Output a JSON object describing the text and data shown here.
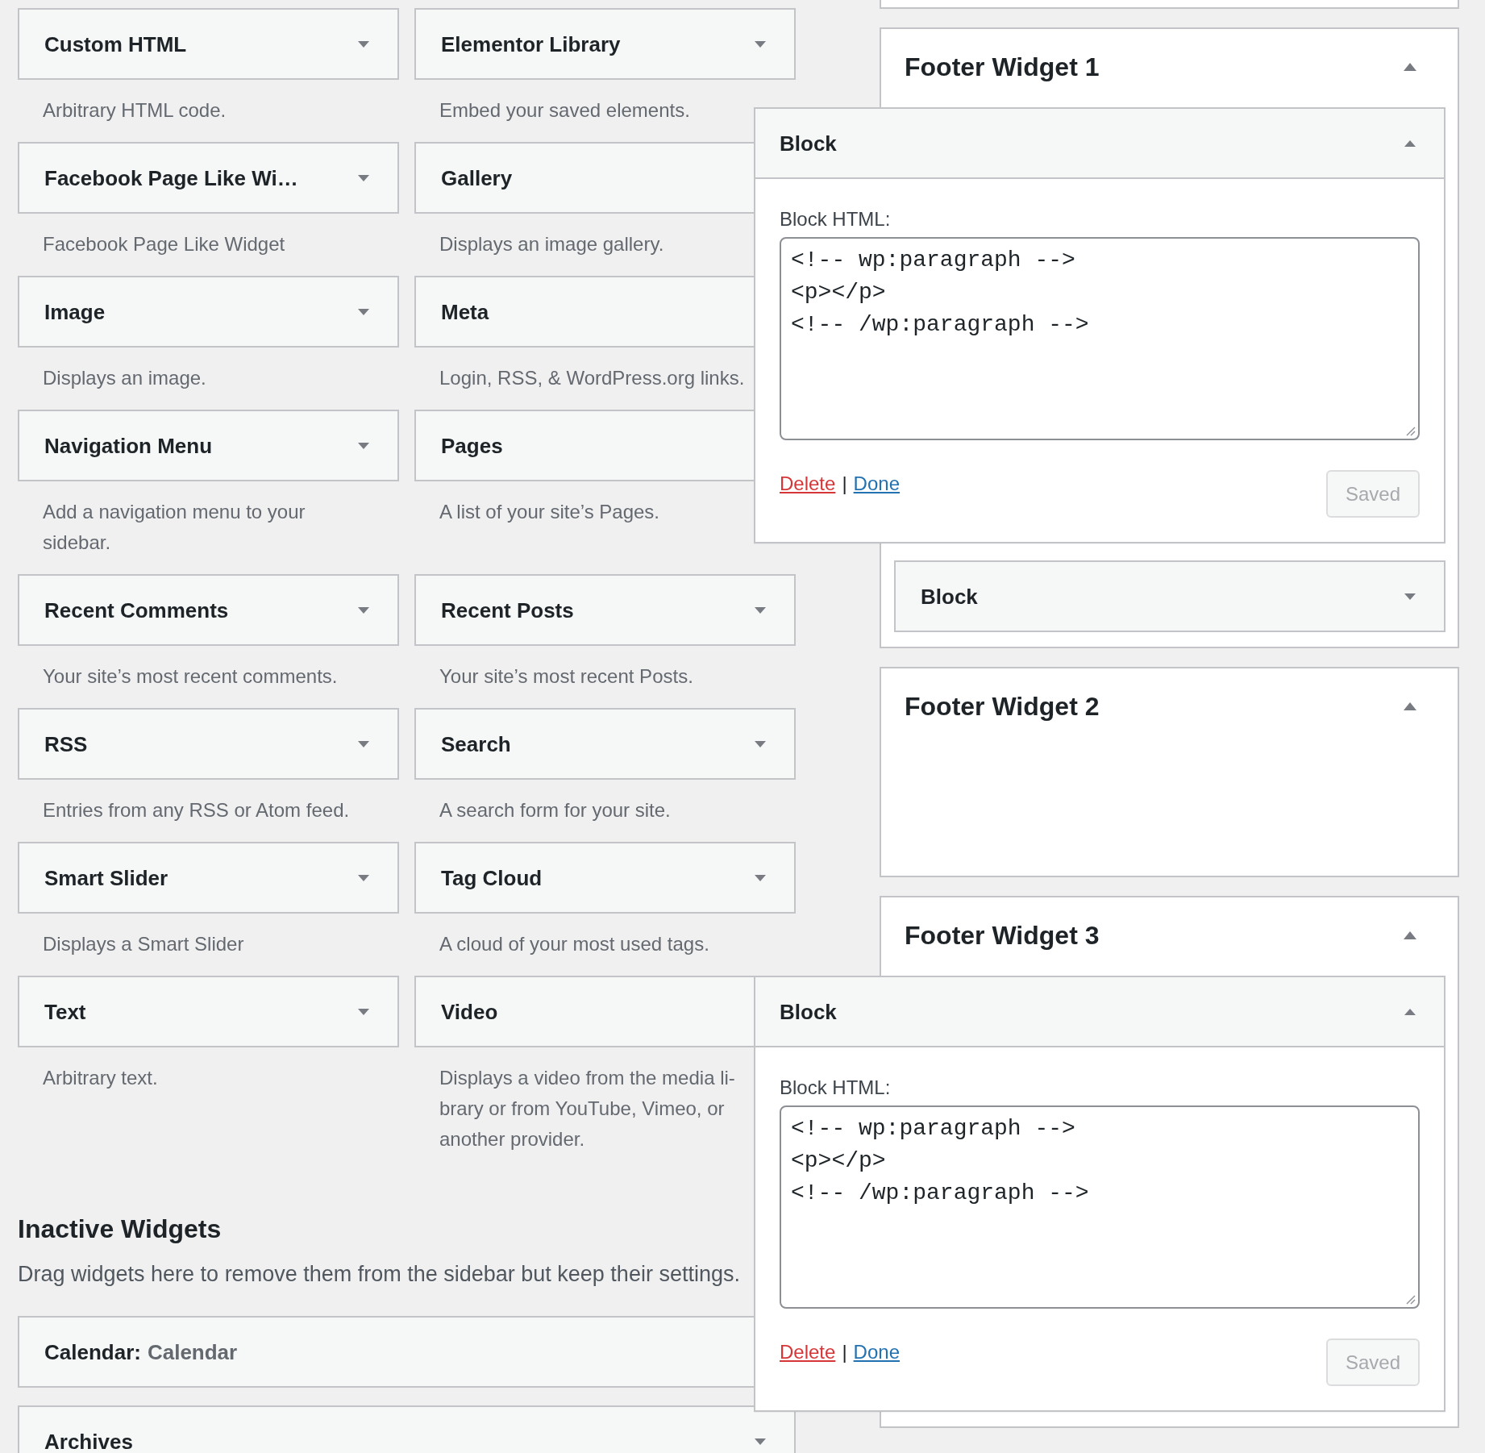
{
  "available_widgets": [
    {
      "title": "Custom HTML",
      "description": "Arbitrary HTML code."
    },
    {
      "title": "Elementor Library",
      "description": "Embed your saved elements."
    },
    {
      "title": "Facebook Page Like Wi…",
      "description": "Facebook Page Like Widget"
    },
    {
      "title": "Gallery",
      "description": "Displays an image gallery."
    },
    {
      "title": "Image",
      "description": "Displays an image."
    },
    {
      "title": "Meta",
      "description": "Login, RSS, & WordPress.org links."
    },
    {
      "title": "Navigation Menu",
      "description": "Add a navigation menu to your sidebar."
    },
    {
      "title": "Pages",
      "description": "A list of your site’s Pages."
    },
    {
      "title": "Recent Comments",
      "description": "Your site’s most recent comments."
    },
    {
      "title": "Recent Posts",
      "description": "Your site’s most recent Posts."
    },
    {
      "title": "RSS",
      "description": "Entries from any RSS or Atom feed."
    },
    {
      "title": "Search",
      "description": "A search form for your site."
    },
    {
      "title": "Smart Slider",
      "description": "Displays a Smart Slider"
    },
    {
      "title": "Tag Cloud",
      "description": "A cloud of your most used tags."
    },
    {
      "title": "Text",
      "description": "Arbitrary text."
    },
    {
      "title": "Video",
      "description": "Displays a video from the media li-brary or from YouTube, Vimeo, or another provider."
    }
  ],
  "inactive_widgets": {
    "heading": "Inactive Widgets",
    "description": "Drag widgets here to remove them from the sidebar but keep their settings.",
    "widgets": [
      {
        "title": "Calendar:",
        "instance_title": "Calendar"
      },
      {
        "title": "Archives"
      }
    ]
  },
  "sidebars": [
    {
      "kind": "edge"
    },
    {
      "kind": "sidebar",
      "title": "Footer Widget 1",
      "expanded": true,
      "widgets": [
        {
          "title": "Block",
          "expanded": true,
          "field_label": "Block HTML:",
          "content": "<!-- wp:paragraph -->\n<p></p>\n<!-- /wp:paragraph -->",
          "delete_link": "Delete",
          "separator": "|",
          "done_link": "Done",
          "save_button": {
            "label": "Saved",
            "disabled": true
          }
        },
        {
          "title": "Block",
          "expanded": false
        }
      ]
    },
    {
      "kind": "sidebar",
      "title": "Footer Widget 2",
      "expanded": true
    },
    {
      "kind": "sidebar",
      "title": "Footer Widget 3",
      "expanded": true,
      "widgets": [
        {
          "title": "Block",
          "expanded": true,
          "field_label": "Block HTML:",
          "content": "<!-- wp:paragraph -->\n<p></p>\n<!-- /wp:paragraph -->",
          "delete_link": "Delete",
          "separator": "|",
          "done_link": "Done",
          "save_button": {
            "label": "Saved",
            "disabled": true
          }
        }
      ]
    }
  ]
}
